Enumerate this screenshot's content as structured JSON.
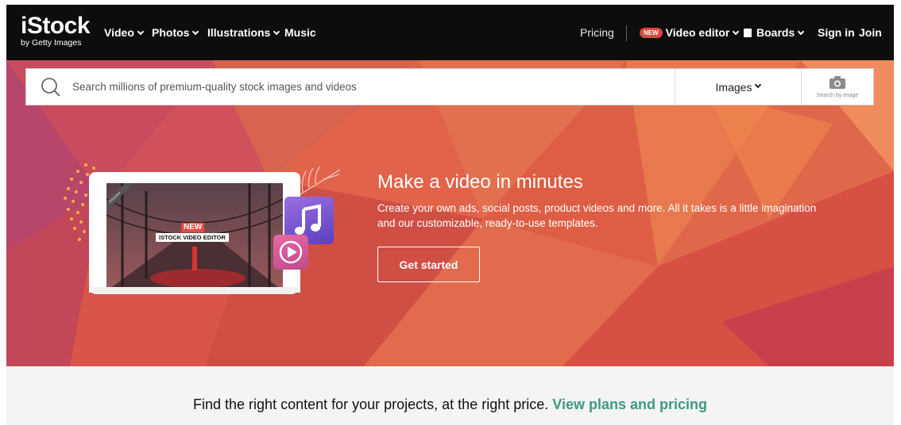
{
  "brand": {
    "name": "iStock",
    "tagline": "by Getty Images"
  },
  "nav": {
    "left": [
      {
        "label": "Video"
      },
      {
        "label": "Photos"
      },
      {
        "label": "Illustrations"
      },
      {
        "label": "Music"
      }
    ],
    "pricing": "Pricing",
    "new_badge": "NEW",
    "video_editor": "Video editor",
    "boards": "Boards",
    "sign_in": "Sign in",
    "join": "Join"
  },
  "search": {
    "placeholder": "Search millions of premium-quality stock images and videos",
    "type_selected": "Images",
    "by_image_label": "Search by image"
  },
  "promo": {
    "screen_ribbon": "Preview",
    "screen_badge": "NEW",
    "screen_title": "ISTOCK VIDEO EDITOR",
    "title": "Make a video in minutes",
    "body": "Create your own ads, social posts, product videos and more. All it takes is a little imagination and our customizable, ready-to-use templates.",
    "cta": "Get started"
  },
  "footer_strip": {
    "text": "Find the right content for your projects, at the right price.",
    "link": "View plans and pricing"
  },
  "colors": {
    "nav_bg": "#0c0d0d",
    "hero_base": "#dc5a4f",
    "accent_link": "#3a9a83",
    "new_badge": "#e0453d"
  }
}
